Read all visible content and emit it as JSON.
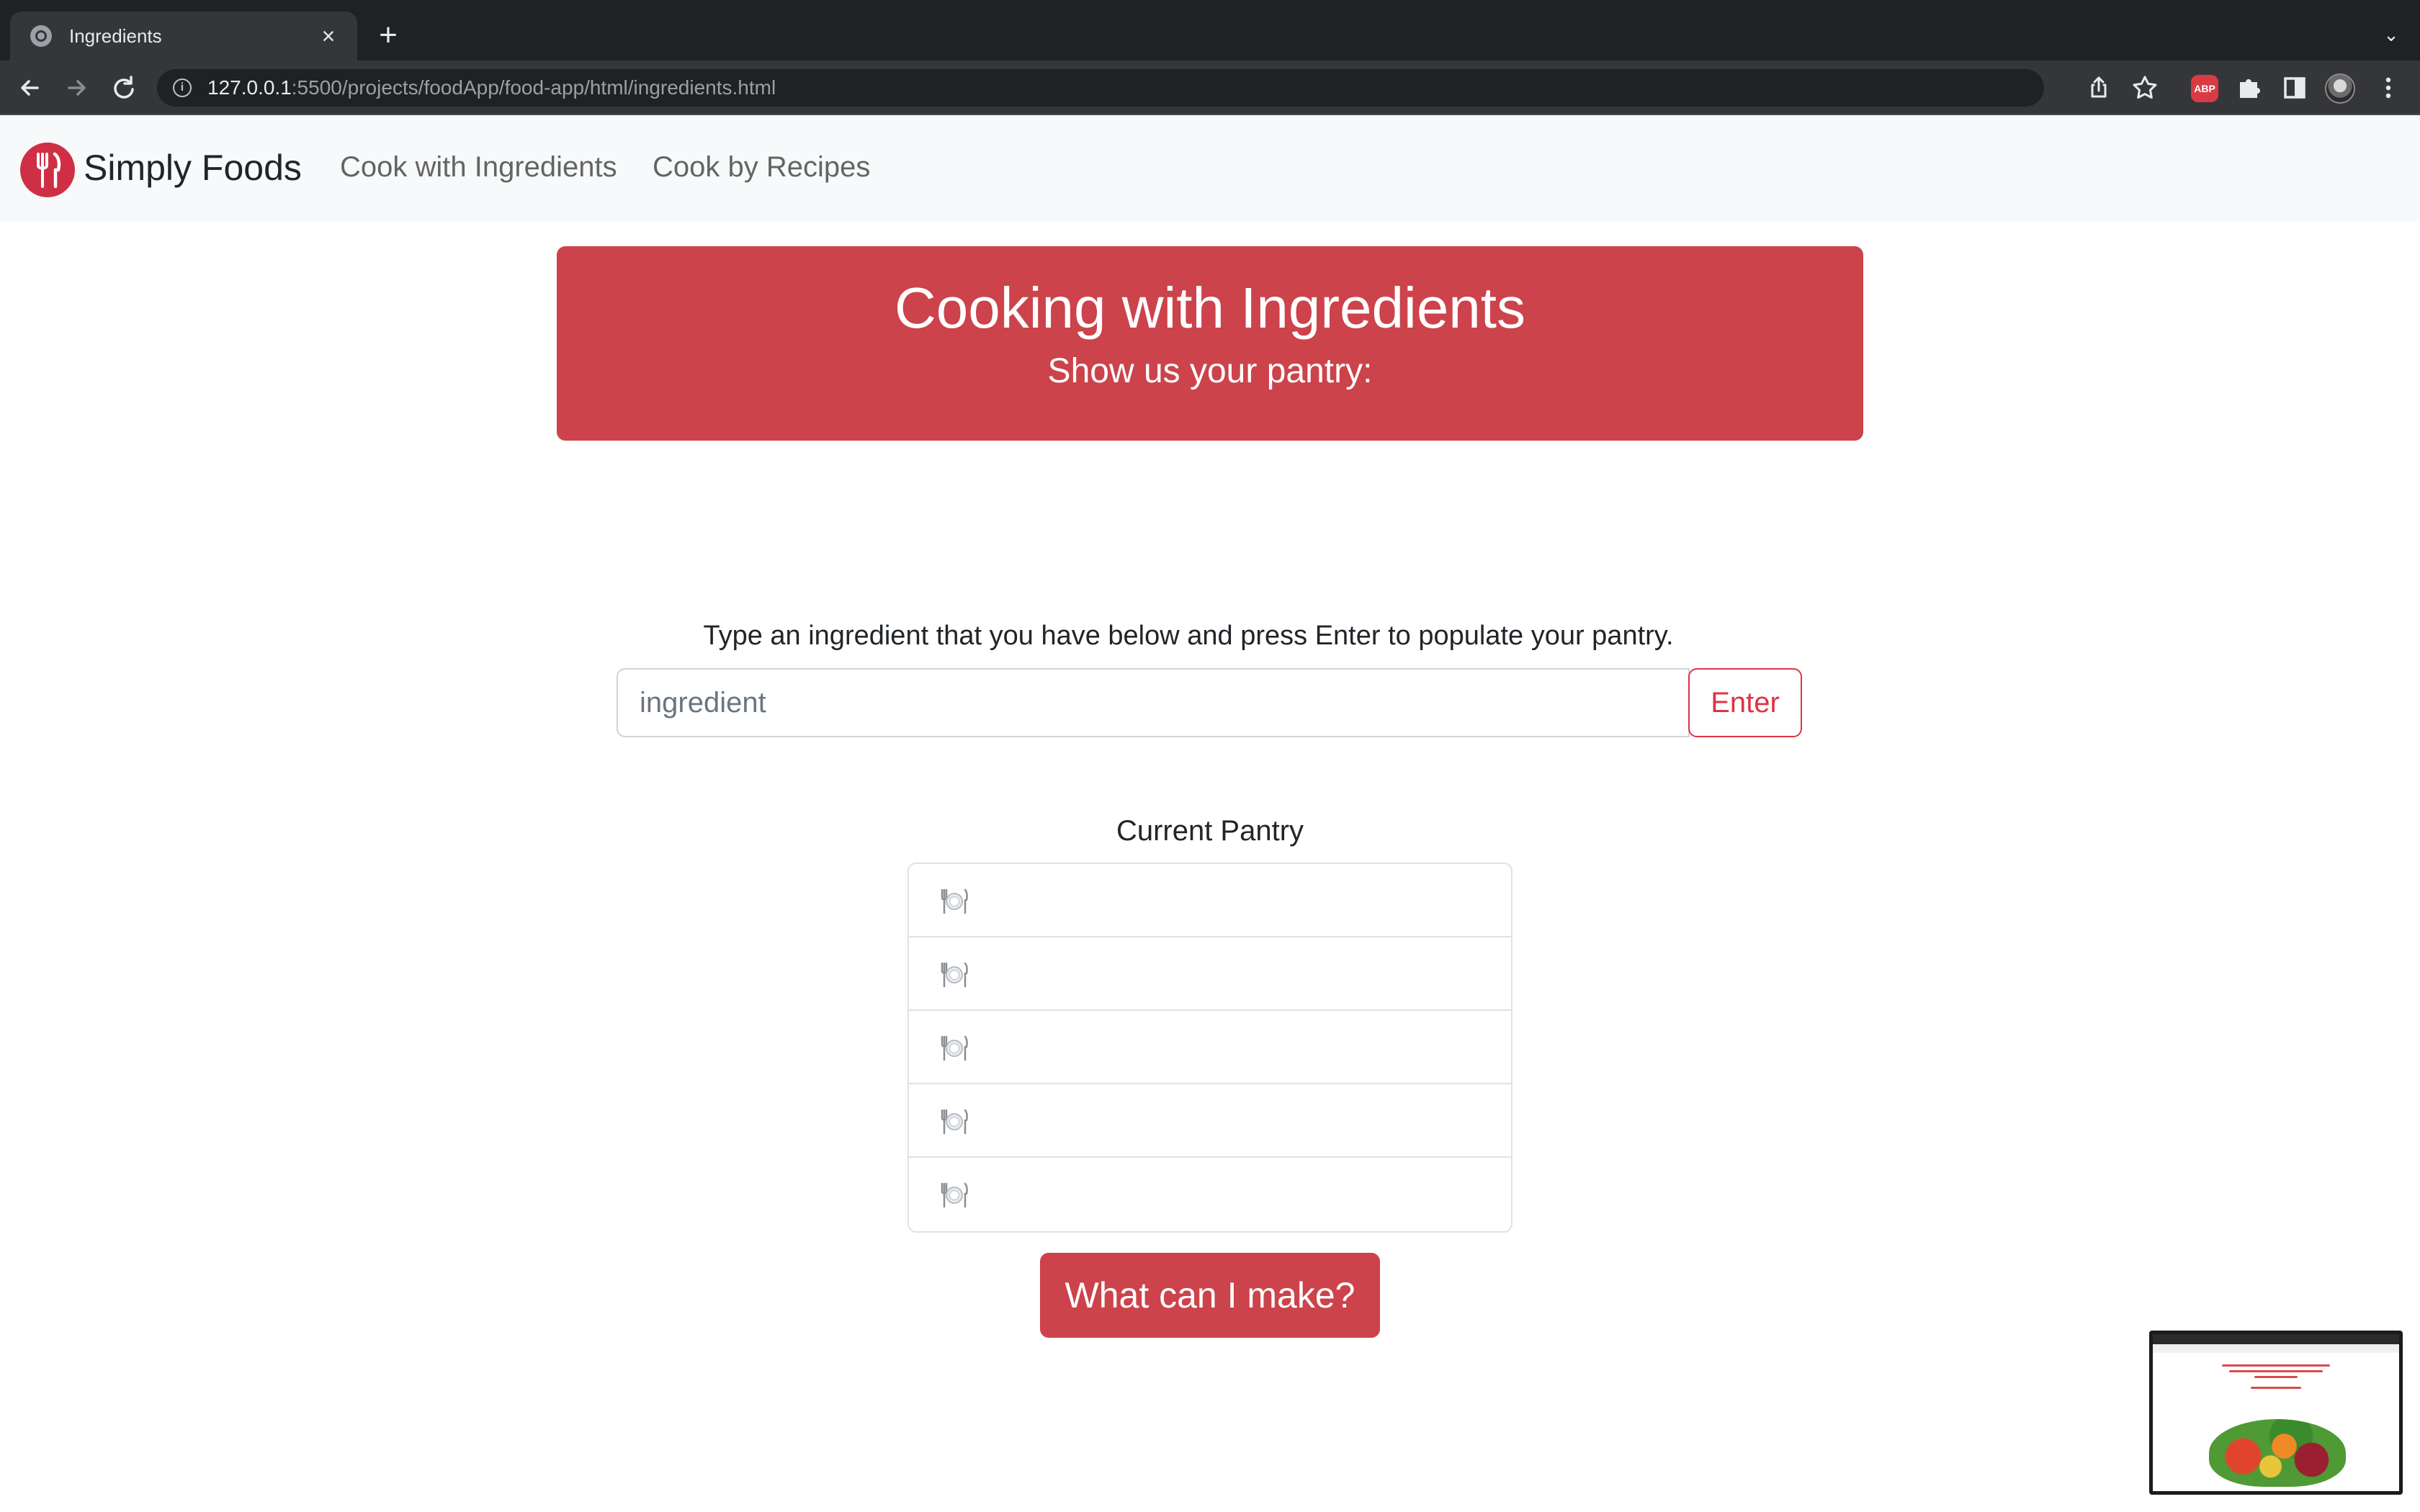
{
  "browser": {
    "tab_title": "Ingredients",
    "tab_close": "×",
    "new_tab": "+",
    "tabs_dropdown": "⌄",
    "url_host": "127.0.0.1",
    "url_rest": ":5500/projects/foodApp/food-app/html/ingredients.html",
    "extension_abp": "ABP"
  },
  "navbar": {
    "brand": "Simply Foods",
    "links": [
      "Cook with Ingredients",
      "Cook by Recipes"
    ]
  },
  "hero": {
    "title": "Cooking with Ingredients",
    "subtitle": "Show us your pantry:"
  },
  "form": {
    "instruction": "Type an ingredient that you have below and press Enter to populate your pantry.",
    "placeholder": "ingredient",
    "enter_label": "Enter"
  },
  "pantry": {
    "title": "Current Pantry",
    "items": [
      "fork-knife-plate-icon",
      "fork-knife-plate-icon",
      "fork-knife-plate-icon",
      "fork-knife-plate-icon",
      "fork-knife-plate-icon"
    ]
  },
  "action": {
    "make_label": "What can I make?"
  },
  "colors": {
    "brand_red": "#cc434b",
    "danger": "#dc3545",
    "navbar_bg": "#f8f9fa"
  }
}
